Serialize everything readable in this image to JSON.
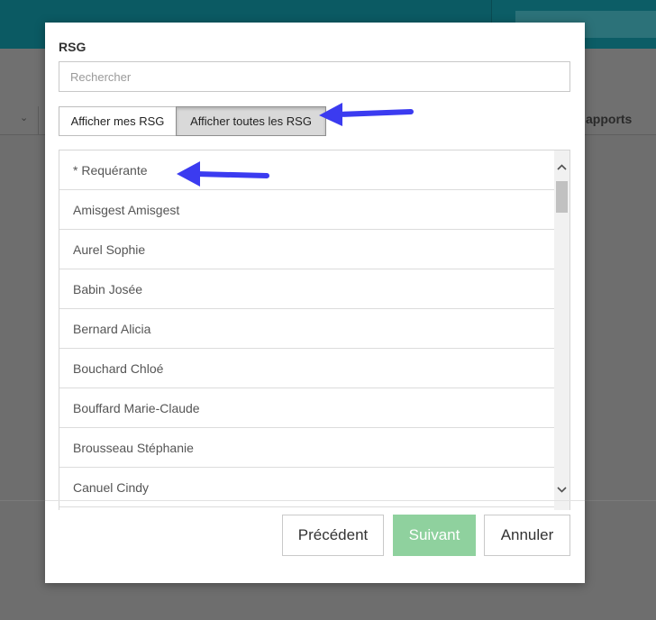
{
  "background": {
    "toolbar_right_label": "apports"
  },
  "dialog": {
    "title": "RSG",
    "search": {
      "placeholder": "Rechercher",
      "value": ""
    },
    "toggle": {
      "mine_label": "Afficher mes RSG",
      "all_label": "Afficher toutes les RSG",
      "active": "all"
    },
    "list_items": [
      "* Requérante",
      "Amisgest Amisgest",
      "Aurel Sophie",
      "Babin Josée",
      "Bernard Alicia",
      "Bouchard Chloé",
      "Bouffard Marie-Claude",
      "Brousseau Stéphanie",
      "Canuel Cindy"
    ],
    "buttons": {
      "previous": "Précédent",
      "next": "Suivant",
      "cancel": "Annuler"
    }
  },
  "colors": {
    "header": "#0b5a63",
    "next_button": "#8fd19e",
    "annotation_arrow": "#3b3bf0"
  },
  "icons": {
    "scroll_up": "chevron-up-icon",
    "scroll_down": "chevron-down-icon",
    "dropdown": "chevron-down-icon"
  }
}
